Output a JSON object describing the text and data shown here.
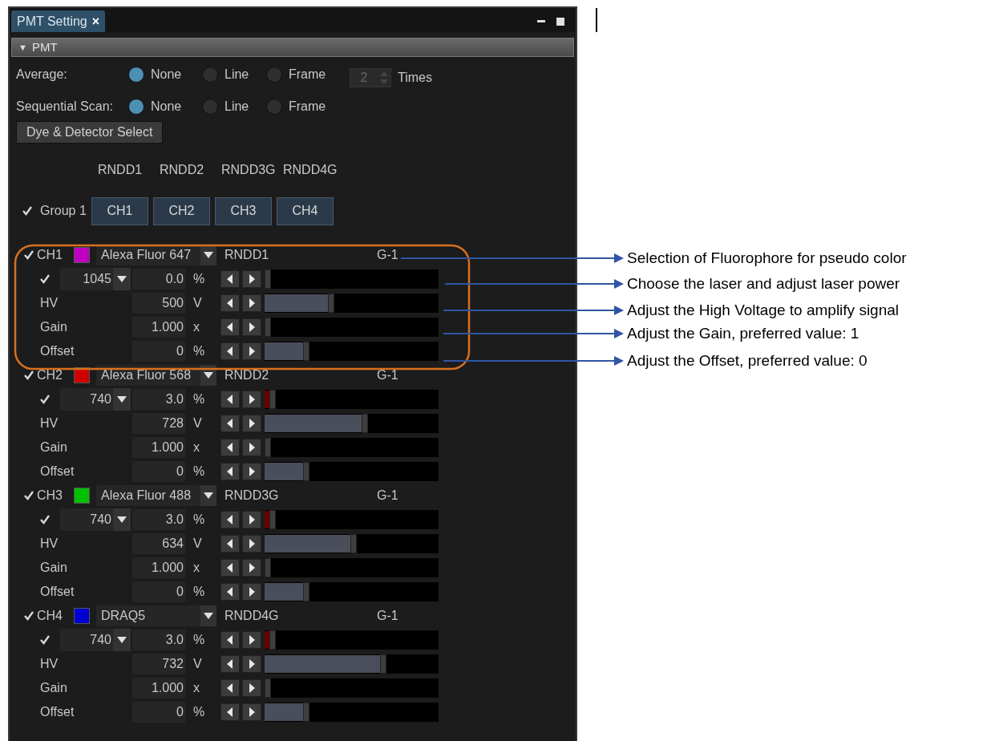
{
  "panel": {
    "tab": {
      "label": "PMT Setting",
      "close": "×"
    },
    "section": {
      "arrow": "▼",
      "title": "PMT"
    },
    "average": {
      "label": "Average:",
      "options": [
        {
          "label": "None",
          "selected": true
        },
        {
          "label": "Line",
          "selected": false
        },
        {
          "label": "Frame",
          "selected": false
        }
      ],
      "count": "2",
      "count_unit": "Times"
    },
    "sequential_scan": {
      "label": "Sequential Scan:",
      "options": [
        {
          "label": "None",
          "selected": true
        },
        {
          "label": "Line",
          "selected": false
        },
        {
          "label": "Frame",
          "selected": false
        }
      ]
    },
    "dye_button": "Dye & Detector Select",
    "group": {
      "detectors": [
        "RNDD1",
        "RNDD2",
        "RNDD3G",
        "RNDD4G"
      ],
      "checked": true,
      "label": "Group 1",
      "channels": [
        "CH1",
        "CH2",
        "CH3",
        "CH4"
      ]
    },
    "channels": [
      {
        "checked": true,
        "name": "CH1",
        "color": "#c000c0",
        "dye": "Alexa Fluor 647",
        "detector": "RNDD1",
        "group": "G-1",
        "laser": {
          "checked": true,
          "wavelength": "1045",
          "value": "0.0",
          "unit": "%",
          "level": 0
        },
        "rows": [
          {
            "label": "HV",
            "value": "500",
            "unit": "V",
            "level": 0.38
          },
          {
            "label": "Gain",
            "value": "1.000",
            "unit": "x",
            "level": 0
          },
          {
            "label": "Offset",
            "value": "0",
            "unit": "%",
            "level": 0.23
          }
        ]
      },
      {
        "checked": true,
        "name": "CH2",
        "color": "#d00000",
        "dye": "Alexa Fluor 568",
        "detector": "RNDD2",
        "group": "G-1",
        "laser": {
          "checked": true,
          "wavelength": "740",
          "value": "3.0",
          "unit": "%",
          "level": 0.03
        },
        "rows": [
          {
            "label": "HV",
            "value": "728",
            "unit": "V",
            "level": 0.58
          },
          {
            "label": "Gain",
            "value": "1.000",
            "unit": "x",
            "level": 0
          },
          {
            "label": "Offset",
            "value": "0",
            "unit": "%",
            "level": 0.23
          }
        ]
      },
      {
        "checked": true,
        "name": "CH3",
        "color": "#00c000",
        "dye": "Alexa Fluor 488",
        "detector": "RNDD3G",
        "group": "G-1",
        "laser": {
          "checked": true,
          "wavelength": "740",
          "value": "3.0",
          "unit": "%",
          "level": 0.03
        },
        "rows": [
          {
            "label": "HV",
            "value": "634",
            "unit": "V",
            "level": 0.51
          },
          {
            "label": "Gain",
            "value": "1.000",
            "unit": "x",
            "level": 0
          },
          {
            "label": "Offset",
            "value": "0",
            "unit": "%",
            "level": 0.23
          }
        ]
      },
      {
        "checked": true,
        "name": "CH4",
        "color": "#0000d0",
        "dye": "DRAQ5",
        "detector": "RNDD4G",
        "group": "G-1",
        "laser": {
          "checked": true,
          "wavelength": "740",
          "value": "3.0",
          "unit": "%",
          "level": 0.03
        },
        "rows": [
          {
            "label": "HV",
            "value": "732",
            "unit": "V",
            "level": 0.69
          },
          {
            "label": "Gain",
            "value": "1.000",
            "unit": "x",
            "level": 0
          },
          {
            "label": "Offset",
            "value": "0",
            "unit": "%",
            "level": 0.23
          }
        ]
      }
    ]
  },
  "annotations": [
    "Selection of Fluorophore for pseudo color",
    "Choose the laser and adjust laser power",
    "Adjust the High Voltage to amplify signal",
    "Adjust the Gain, preferred value: 1",
    "Adjust the Offset, preferred value: 0"
  ]
}
